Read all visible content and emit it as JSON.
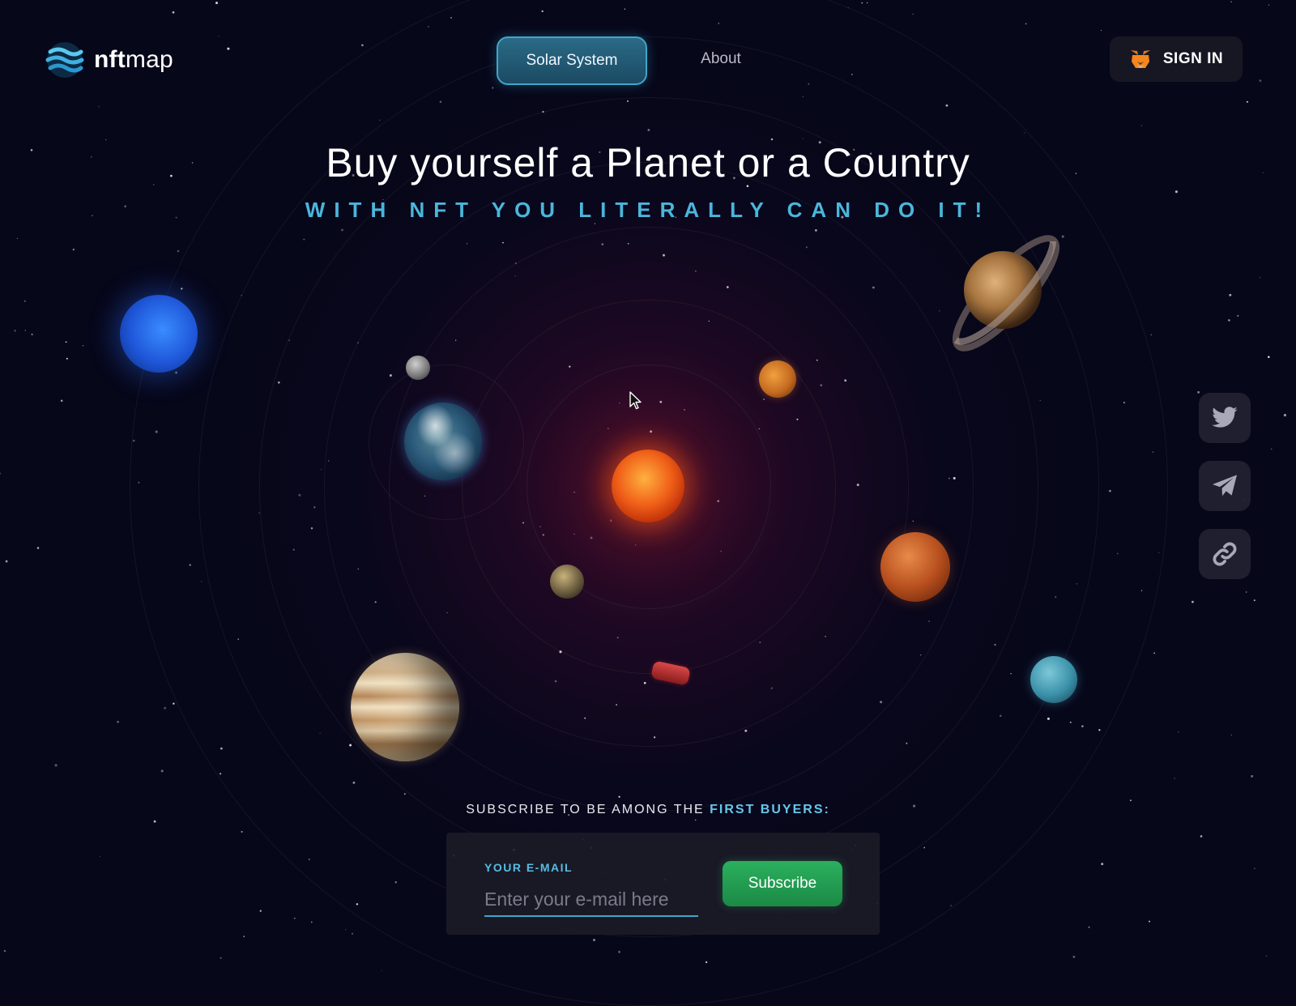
{
  "brand": {
    "name_bold": "nft",
    "name_light": "map"
  },
  "nav": {
    "items": [
      {
        "label": "Solar System",
        "active": true
      },
      {
        "label": "About",
        "active": false
      }
    ]
  },
  "header": {
    "signin_label": "SIGN IN"
  },
  "hero": {
    "title": "Buy yourself a Planet or a Country",
    "subtitle": "WITH NFT YOU LITERALLY CAN DO IT!"
  },
  "social": [
    {
      "icon": "twitter-icon"
    },
    {
      "icon": "telegram-icon"
    },
    {
      "icon": "link-icon"
    }
  ],
  "subscribe": {
    "prefix": "SUBSCRIBE TO BE AMONG THE ",
    "highlight": "FIRST BUYERS:",
    "email_label": "YOUR E-MAIL",
    "email_placeholder": "Enter your e-mail here",
    "email_value": "",
    "button_label": "Subscribe"
  },
  "colors": {
    "accent": "#4bb6dc",
    "button_green": "#22a052",
    "background": "#07071a"
  }
}
